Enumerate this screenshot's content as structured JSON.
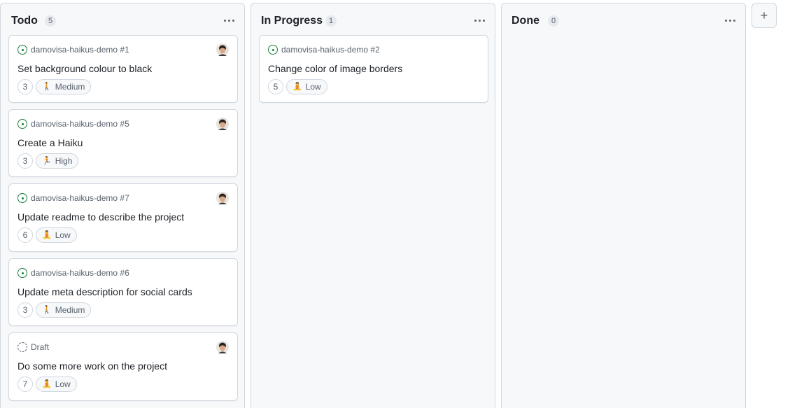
{
  "columns": [
    {
      "title": "Todo",
      "count": "5",
      "cards": [
        {
          "ref": "damovisa-haikus-demo #1",
          "type": "issue",
          "title": "Set background colour to black",
          "estimate": "3",
          "priority": "Medium",
          "priority_emoji": "🚶",
          "has_avatar": true
        },
        {
          "ref": "damovisa-haikus-demo #5",
          "type": "issue",
          "title": "Create a Haiku",
          "estimate": "3",
          "priority": "High",
          "priority_emoji": "🏃",
          "has_avatar": true
        },
        {
          "ref": "damovisa-haikus-demo #7",
          "type": "issue",
          "title": "Update readme to describe the project",
          "estimate": "6",
          "priority": "Low",
          "priority_emoji": "🧘",
          "has_avatar": true
        },
        {
          "ref": "damovisa-haikus-demo #6",
          "type": "issue",
          "title": "Update meta description for social cards",
          "estimate": "3",
          "priority": "Medium",
          "priority_emoji": "🚶",
          "has_avatar": false
        },
        {
          "ref": "Draft",
          "type": "draft",
          "title": "Do some more work on the project",
          "estimate": "7",
          "priority": "Low",
          "priority_emoji": "🧘",
          "has_avatar": true
        }
      ]
    },
    {
      "title": "In Progress",
      "count": "1",
      "cards": [
        {
          "ref": "damovisa-haikus-demo #2",
          "type": "issue",
          "title": "Change color of image borders",
          "estimate": "5",
          "priority": "Low",
          "priority_emoji": "🧘",
          "has_avatar": false
        }
      ]
    },
    {
      "title": "Done",
      "count": "0",
      "cards": []
    }
  ],
  "add_column_label": "+",
  "colors": {
    "issue_open": "#1a7f37",
    "border": "#d0d7de",
    "muted": "#59636e"
  }
}
